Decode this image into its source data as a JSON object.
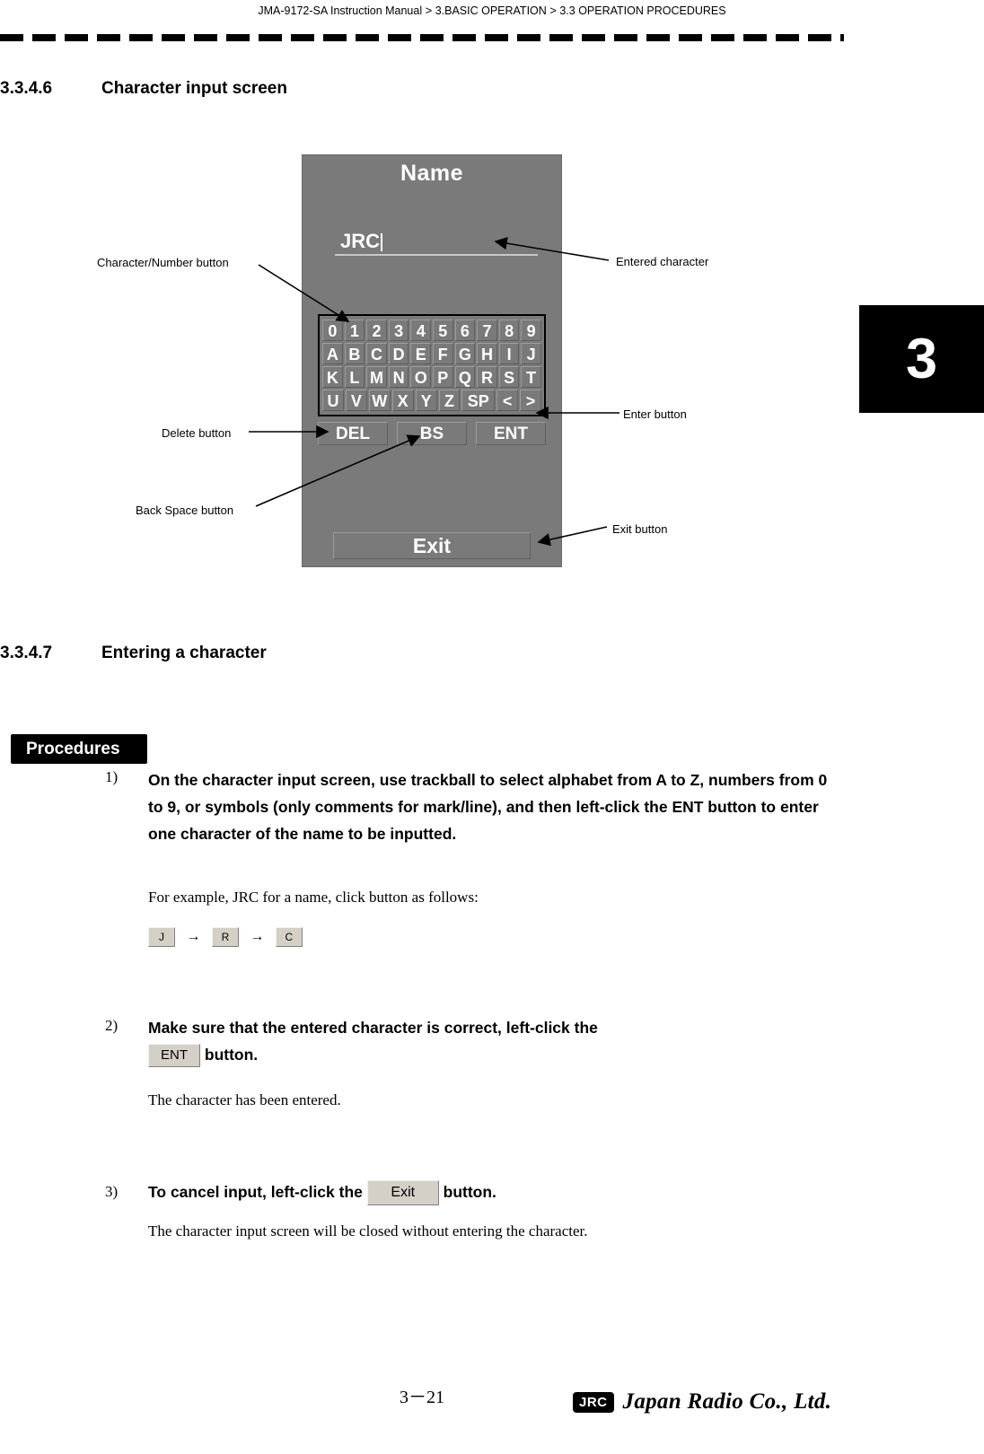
{
  "header": {
    "manual": "JMA-9172-SA Instruction Manual",
    "sep1": ">",
    "chapter": "3.BASIC OPERATION",
    "sep2": ">",
    "section": "3.3  OPERATION PROCEDURES"
  },
  "chapter_tab": "3",
  "sections": [
    {
      "number": "3.3.4.6",
      "title": "Character input screen"
    },
    {
      "number": "3.3.4.7",
      "title": "Entering a character"
    }
  ],
  "figure": {
    "screen_title": "Name",
    "entered_text": "JRC",
    "keypad_rows": [
      [
        "0",
        "1",
        "2",
        "3",
        "4",
        "5",
        "6",
        "7",
        "8",
        "9"
      ],
      [
        "A",
        "B",
        "C",
        "D",
        "E",
        "F",
        "G",
        "H",
        "I",
        "J"
      ],
      [
        "K",
        "L",
        "M",
        "N",
        "O",
        "P",
        "Q",
        "R",
        "S",
        "T"
      ],
      [
        "U",
        "V",
        "W",
        "X",
        "Y",
        "Z",
        "SP",
        "<",
        ">"
      ]
    ],
    "function_keys": [
      "DEL",
      "BS",
      "ENT"
    ],
    "exit_label": "Exit",
    "callouts": {
      "char_number": "Character/Number button",
      "delete": "Delete button",
      "back_space": "Back Space button",
      "entered_character": "Entered character",
      "enter": "Enter button",
      "exit": "Exit button"
    }
  },
  "procedures": {
    "badge": "Procedures",
    "steps": [
      {
        "num": "1)",
        "text": "On the character input screen, use trackball to select alphabet from A to Z, numbers from 0 to 9, or symbols (only comments for mark/line), and then left-click the  ENT  button to enter one character of the name to be inputted.",
        "note": "For example, JRC for a name, click button as follows:",
        "sequence": [
          "J",
          "R",
          "C"
        ],
        "arrow": "→"
      },
      {
        "num": "2)",
        "text_before": "Make sure that the entered character is correct, left-click the",
        "key": "ENT",
        "text_after": "button.",
        "note": "The character has been entered."
      },
      {
        "num": "3)",
        "text_before": "To cancel input, left-click the",
        "key": "Exit",
        "text_after": "button.",
        "note": "The character input screen will be closed without entering the character."
      }
    ]
  },
  "footer": {
    "page": "3－21",
    "logo_mark": "JRC",
    "logo_name": "Japan Radio Co., Ltd."
  }
}
